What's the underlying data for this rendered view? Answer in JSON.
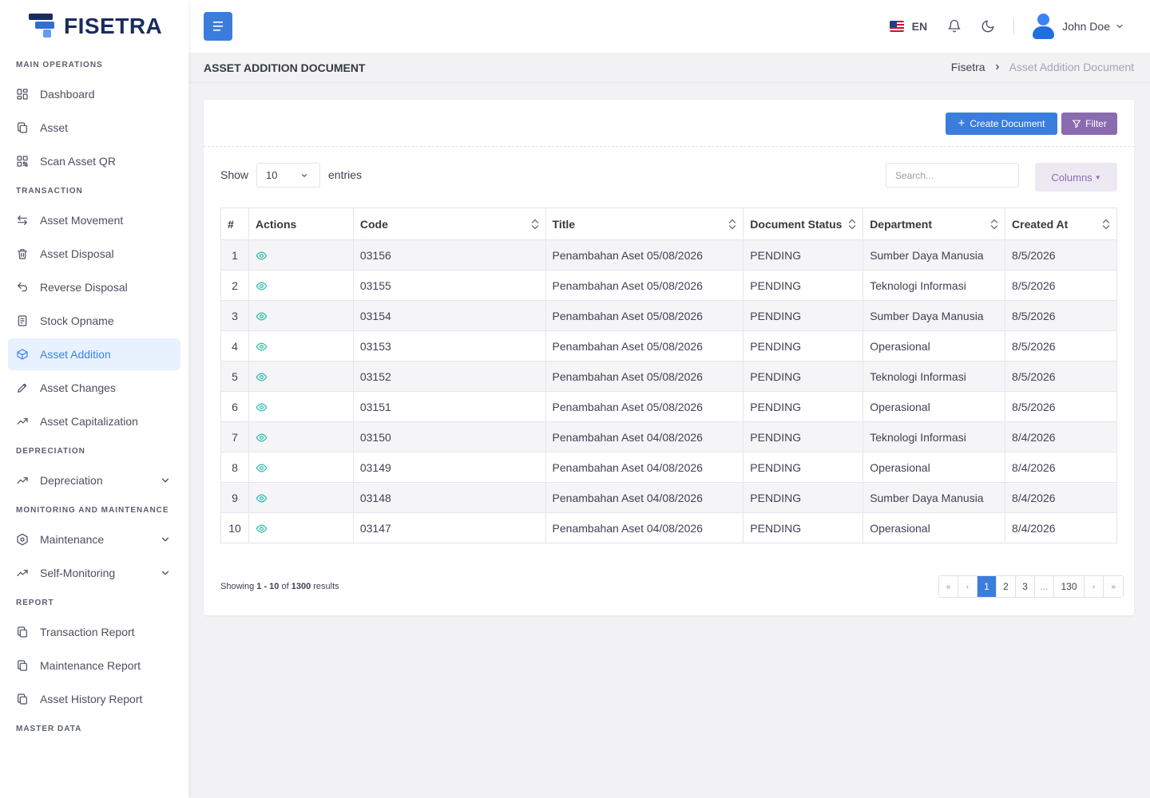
{
  "app": {
    "logo_text": "FISETRA"
  },
  "sidebar": {
    "sections": [
      {
        "title": "MAIN OPERATIONS",
        "items": [
          {
            "label": "Dashboard",
            "icon": "grid-icon"
          },
          {
            "label": "Asset",
            "icon": "copy-icon"
          },
          {
            "label": "Scan Asset QR",
            "icon": "qr-icon"
          }
        ]
      },
      {
        "title": "TRANSACTION",
        "items": [
          {
            "label": "Asset Movement",
            "icon": "swap-icon"
          },
          {
            "label": "Asset Disposal",
            "icon": "trash-icon"
          },
          {
            "label": "Reverse Disposal",
            "icon": "undo-icon"
          },
          {
            "label": "Stock Opname",
            "icon": "clipboard-icon"
          },
          {
            "label": "Asset Addition",
            "icon": "box-add-icon",
            "active": true
          },
          {
            "label": "Asset Changes",
            "icon": "pencil-icon"
          },
          {
            "label": "Asset Capitalization",
            "icon": "trend-up-icon"
          }
        ]
      },
      {
        "title": "DEPRECIATION",
        "items": [
          {
            "label": "Depreciation",
            "icon": "trend-up-icon",
            "expandable": true
          }
        ]
      },
      {
        "title": "MONITORING AND MAINTENANCE",
        "items": [
          {
            "label": "Maintenance",
            "icon": "hexagon-icon",
            "expandable": true
          },
          {
            "label": "Self-Monitoring",
            "icon": "trend-up-icon",
            "expandable": true
          }
        ]
      },
      {
        "title": "REPORT",
        "items": [
          {
            "label": "Transaction Report",
            "icon": "copy-icon"
          },
          {
            "label": "Maintenance Report",
            "icon": "copy-icon"
          },
          {
            "label": "Asset History Report",
            "icon": "copy-icon"
          }
        ]
      },
      {
        "title": "MASTER DATA",
        "items": []
      }
    ]
  },
  "topbar": {
    "language": "EN",
    "user_name": "John Doe"
  },
  "page": {
    "title": "ASSET ADDITION DOCUMENT",
    "breadcrumb_home": "Fisetra",
    "breadcrumb_current": "Asset Addition Document"
  },
  "toolbar": {
    "create_label": "Create Document",
    "filter_label": "Filter",
    "columns_label": "Columns"
  },
  "table_controls": {
    "show_label": "Show",
    "entries_value": "10",
    "entries_label": "entries",
    "search_placeholder": "Search..."
  },
  "table": {
    "headers": [
      "#",
      "Actions",
      "Code",
      "Title",
      "Document Status",
      "Department",
      "Created At"
    ],
    "rows": [
      {
        "num": "1",
        "code": "03156",
        "title": "Penambahan Aset 05/08/2026",
        "status": "PENDING",
        "department": "Sumber Daya Manusia",
        "created": "8/5/2026"
      },
      {
        "num": "2",
        "code": "03155",
        "title": "Penambahan Aset 05/08/2026",
        "status": "PENDING",
        "department": "Teknologi Informasi",
        "created": "8/5/2026"
      },
      {
        "num": "3",
        "code": "03154",
        "title": "Penambahan Aset 05/08/2026",
        "status": "PENDING",
        "department": "Sumber Daya Manusia",
        "created": "8/5/2026"
      },
      {
        "num": "4",
        "code": "03153",
        "title": "Penambahan Aset 05/08/2026",
        "status": "PENDING",
        "department": "Operasional",
        "created": "8/5/2026"
      },
      {
        "num": "5",
        "code": "03152",
        "title": "Penambahan Aset 05/08/2026",
        "status": "PENDING",
        "department": "Teknologi Informasi",
        "created": "8/5/2026"
      },
      {
        "num": "6",
        "code": "03151",
        "title": "Penambahan Aset 05/08/2026",
        "status": "PENDING",
        "department": "Operasional",
        "created": "8/5/2026"
      },
      {
        "num": "7",
        "code": "03150",
        "title": "Penambahan Aset 04/08/2026",
        "status": "PENDING",
        "department": "Teknologi Informasi",
        "created": "8/4/2026"
      },
      {
        "num": "8",
        "code": "03149",
        "title": "Penambahan Aset 04/08/2026",
        "status": "PENDING",
        "department": "Operasional",
        "created": "8/4/2026"
      },
      {
        "num": "9",
        "code": "03148",
        "title": "Penambahan Aset 04/08/2026",
        "status": "PENDING",
        "department": "Sumber Daya Manusia",
        "created": "8/4/2026"
      },
      {
        "num": "10",
        "code": "03147",
        "title": "Penambahan Aset 04/08/2026",
        "status": "PENDING",
        "department": "Operasional",
        "created": "8/4/2026"
      }
    ]
  },
  "footer": {
    "showing_prefix": "Showing",
    "showing_range": "1 - 10",
    "showing_of": "of",
    "showing_total": "1300",
    "showing_suffix": "results"
  },
  "pagination": {
    "first": "«",
    "prev": "‹",
    "pages": [
      "1",
      "2",
      "3"
    ],
    "ellipsis": "...",
    "last_page": "130",
    "next": "›",
    "last": "»",
    "current": "1"
  },
  "colors": {
    "primary": "#3b7ddd",
    "filter": "#8a6bb0",
    "active_nav_bg": "#e8f1fe",
    "action_icon": "#2bbbad"
  }
}
